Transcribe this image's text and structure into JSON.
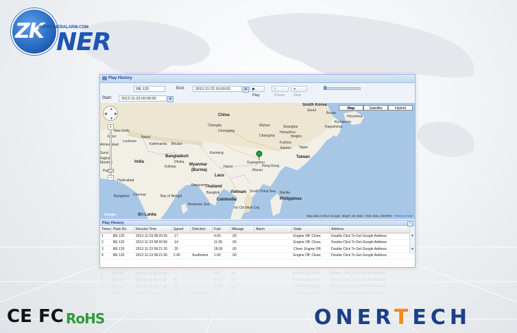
{
  "logo": {
    "mark": "ZK",
    "wordmark": "NER",
    "url": "WWW.ONERALARM.COM"
  },
  "window": {
    "title": "Play History",
    "vehicle_value": "BE 120",
    "end_label": "End:",
    "end_value": "2012-11-23 10:00:00",
    "start_label": "Start:",
    "start_value": "2012-11-23 00:00:00",
    "play_label": "Play",
    "pause_label": "Pause",
    "stop_label": "Stop",
    "speed_slider_fraction": 0.0
  },
  "map": {
    "types": [
      "Map",
      "Satellite",
      "Hybrid"
    ],
    "active_type": "Map",
    "places": {
      "south_korea": "South Korea",
      "seoul": "Seoul",
      "busan": "Busan",
      "japan_cities": "Hiroshima",
      "kagoshima": "Kagoshima",
      "kumamoto": "Kumamoto",
      "china": "China",
      "chengdu": "Chengdu",
      "chongqing": "Chongqing",
      "wuhan": "Wuhan",
      "hangzhou": "Hangzhou",
      "changsha": "Changsha",
      "shanghai": "Shanghai",
      "ningbo": "Ningbo",
      "fuzhou": "Fuzhou",
      "xiamen": "Xiamen",
      "taipei": "Taipei",
      "taiwan": "Taiwan",
      "guangzhou": "Guangzhou",
      "hong_kong": "Hong Kong",
      "macau": "Macau",
      "kunming": "Kunming",
      "nepal": "Nepal",
      "new_delhi": "New Delhi",
      "kathmandu": "Kathmandu",
      "bhutan": "Bhutan",
      "lucknow": "Lucknow",
      "bangladesh": "Bangladesh",
      "dhaka": "Dhaka",
      "kolkata": "Kolkata",
      "india": "India",
      "myanmar": "Myanmar",
      "burma": "(Burma)",
      "laos": "Laos",
      "hanoi": "Hanoi",
      "thailand": "Thailand",
      "bangkok": "Bangkok",
      "vietnam": "Vietnam",
      "cambodia": "Cambodia",
      "andaman_sea": "Andaman Sea",
      "bay_of_bengal": "Bay of Bengal",
      "hyderabad": "Hyderabad",
      "bangalore": "Bangalore",
      "chennai": "Chennai",
      "sri_lanka": "Sri Lanka",
      "philippines": "Philippines",
      "manila": "Manila",
      "south_china_sea": "South China Sea",
      "ahmedabad": "Ahmedabad",
      "ho_chi_minh": "Ho Chi Minh City",
      "jaipur": "Jaipur",
      "pune": "Pune",
      "surat": "Surat",
      "mumbai": "Mumbai",
      "kolkata2": "Rangoon",
      "rajkot": "Rajkot"
    },
    "google_label": "Google",
    "attribution": "Map data ©2012 Google, MapIT, SK M&C, Tele Atlas, ZENRIN",
    "terms": "Terms of Use"
  },
  "history": {
    "title": "Play History",
    "columns": [
      "Times",
      "Plate No.",
      "Receive Time",
      "Speed",
      "Direction",
      "Fuel",
      "Mileage",
      "Alarm",
      "State",
      "Address"
    ],
    "rows": [
      [
        "1",
        "BE 120",
        "2012-11-23 08:20:26",
        ".17",
        "",
        "4.00",
        ".00",
        "",
        "Engine Off; Close;",
        "Double Click To Get Google Address"
      ],
      [
        "2",
        "BE 120",
        "2012-11-23 08:20:56",
        ".14",
        "",
        "11.00",
        ".00",
        "",
        "Engine Off; Close;",
        "Double Click To Get Google Address"
      ],
      [
        "3",
        "BE 120",
        "2012-11-23 08:21:26",
        ".20",
        "",
        "18.00",
        ".00",
        "",
        "Close; Engine Off;",
        "Double Click To Get Google Address"
      ],
      [
        "4",
        "BE 120",
        "2012-11-23 08:21:56",
        "2.45",
        "Southwest",
        "1.00",
        ".00",
        "",
        "Engine Off; Close;",
        "Double Click To Get Google Address"
      ]
    ]
  },
  "footer": {
    "ce": "CE",
    "fc": "FC",
    "rohs": "RoHS",
    "brand_a": "ONER",
    "brand_b": "T",
    "brand_c": "ECH"
  },
  "colors": {
    "brand_blue": "#1d3f88",
    "brand_orange": "#f28a18",
    "rohs_green": "#2e9b3a",
    "panel_blue": "#15428b"
  }
}
